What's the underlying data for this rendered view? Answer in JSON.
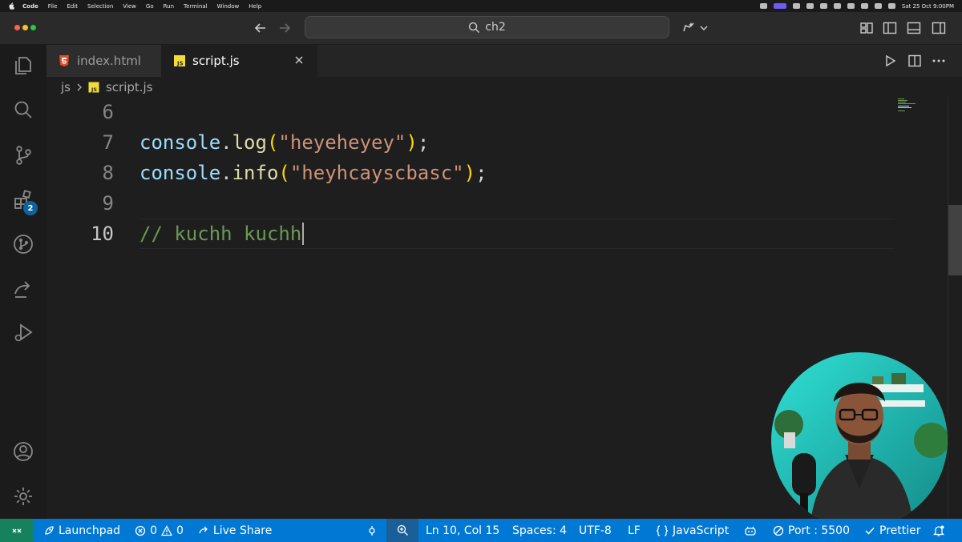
{
  "menubar": {
    "app": "Code",
    "items": [
      "File",
      "Edit",
      "Selection",
      "View",
      "Go",
      "Run",
      "Terminal",
      "Window",
      "Help"
    ],
    "datetime": "Sat 25 Oct 9:00PM"
  },
  "titlebar": {
    "search_text": "ch2"
  },
  "activity": {
    "extensions_badge": "2"
  },
  "tabs": [
    {
      "label": "index.html",
      "icon": "html5-icon"
    },
    {
      "label": "script.js",
      "icon": "js-icon"
    }
  ],
  "breadcrumb": {
    "folder": "js",
    "file": "script.js"
  },
  "editor": {
    "lines": [
      {
        "num": "6",
        "tokens": []
      },
      {
        "num": "7",
        "tokens": [
          {
            "t": "console",
            "c": "var"
          },
          {
            "t": ".",
            "c": "punc"
          },
          {
            "t": "log",
            "c": "fn"
          },
          {
            "t": "(",
            "c": "paren"
          },
          {
            "t": "\"heyeheyey\"",
            "c": "str"
          },
          {
            "t": ")",
            "c": "paren"
          },
          {
            "t": ";",
            "c": "punc"
          }
        ]
      },
      {
        "num": "8",
        "tokens": [
          {
            "t": "console",
            "c": "var"
          },
          {
            "t": ".",
            "c": "punc"
          },
          {
            "t": "info",
            "c": "fn"
          },
          {
            "t": "(",
            "c": "paren"
          },
          {
            "t": "\"heyhcayscbasc\"",
            "c": "str"
          },
          {
            "t": ")",
            "c": "paren"
          },
          {
            "t": ";",
            "c": "punc"
          }
        ]
      },
      {
        "num": "9",
        "tokens": []
      },
      {
        "num": "10",
        "tokens": [
          {
            "t": "// kuchh kuchh",
            "c": "cm"
          }
        ]
      }
    ]
  },
  "statusbar": {
    "launchpad": "Launchpad",
    "errors": "0",
    "warnings": "0",
    "live_share": "Live Share",
    "position": "Ln 10, Col 15",
    "spaces": "Spaces: 4",
    "encoding": "UTF-8",
    "eol": "LF",
    "language": "JavaScript",
    "port": "Port : 5500",
    "prettier": "Prettier"
  },
  "colors": {
    "statusbar": "#0078d4",
    "remote": "#16825d",
    "comment": "#6a9955",
    "string": "#ce9178",
    "variable": "#9cdcfe",
    "function": "#dcdcaa"
  }
}
